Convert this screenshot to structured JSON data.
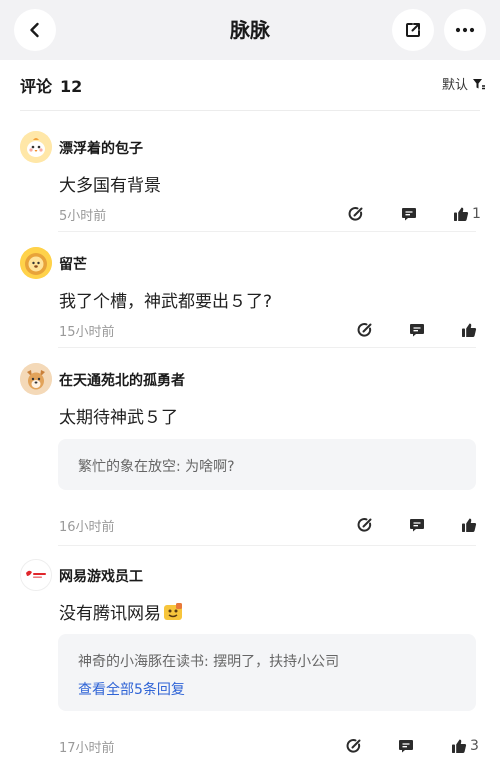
{
  "header": {
    "title": "脉脉",
    "back_icon": "chevron-left-icon",
    "share_icon": "share-icon",
    "more_icon": "more-dots-icon"
  },
  "comments_section": {
    "label": "评论",
    "count": "12",
    "sort_label": "默认",
    "sort_icon": "filter-funnel-icon"
  },
  "comments": [
    {
      "author": "漂浮着的包子",
      "avatar": "chick-avatar",
      "body": "大多国有背景",
      "time": "5小时前",
      "likes": "1"
    },
    {
      "author": "留芒",
      "avatar": "lion-avatar",
      "body": "我了个槽，神武都要出５了?",
      "time": "15小时前",
      "likes": ""
    },
    {
      "author": "在天通苑北的孤勇者",
      "avatar": "dog-avatar",
      "body": "太期待神武５了",
      "reply": "繁忙的象在放空: 为啥啊?",
      "time": "16小时前",
      "likes": ""
    },
    {
      "author": "网易游戏员工",
      "avatar": "netease-logo-avatar",
      "body": "没有腾讯网易",
      "reply": "神奇的小海豚在读书: 摆明了，扶持小公司",
      "reply_more": "查看全部5条回复",
      "time": "17小时前",
      "likes": "3"
    }
  ],
  "colors": {
    "link": "#2f64d6",
    "nav_bg": "#f2f2f4",
    "reply_bg": "#f4f5f7",
    "muted": "#9a9a9a"
  }
}
